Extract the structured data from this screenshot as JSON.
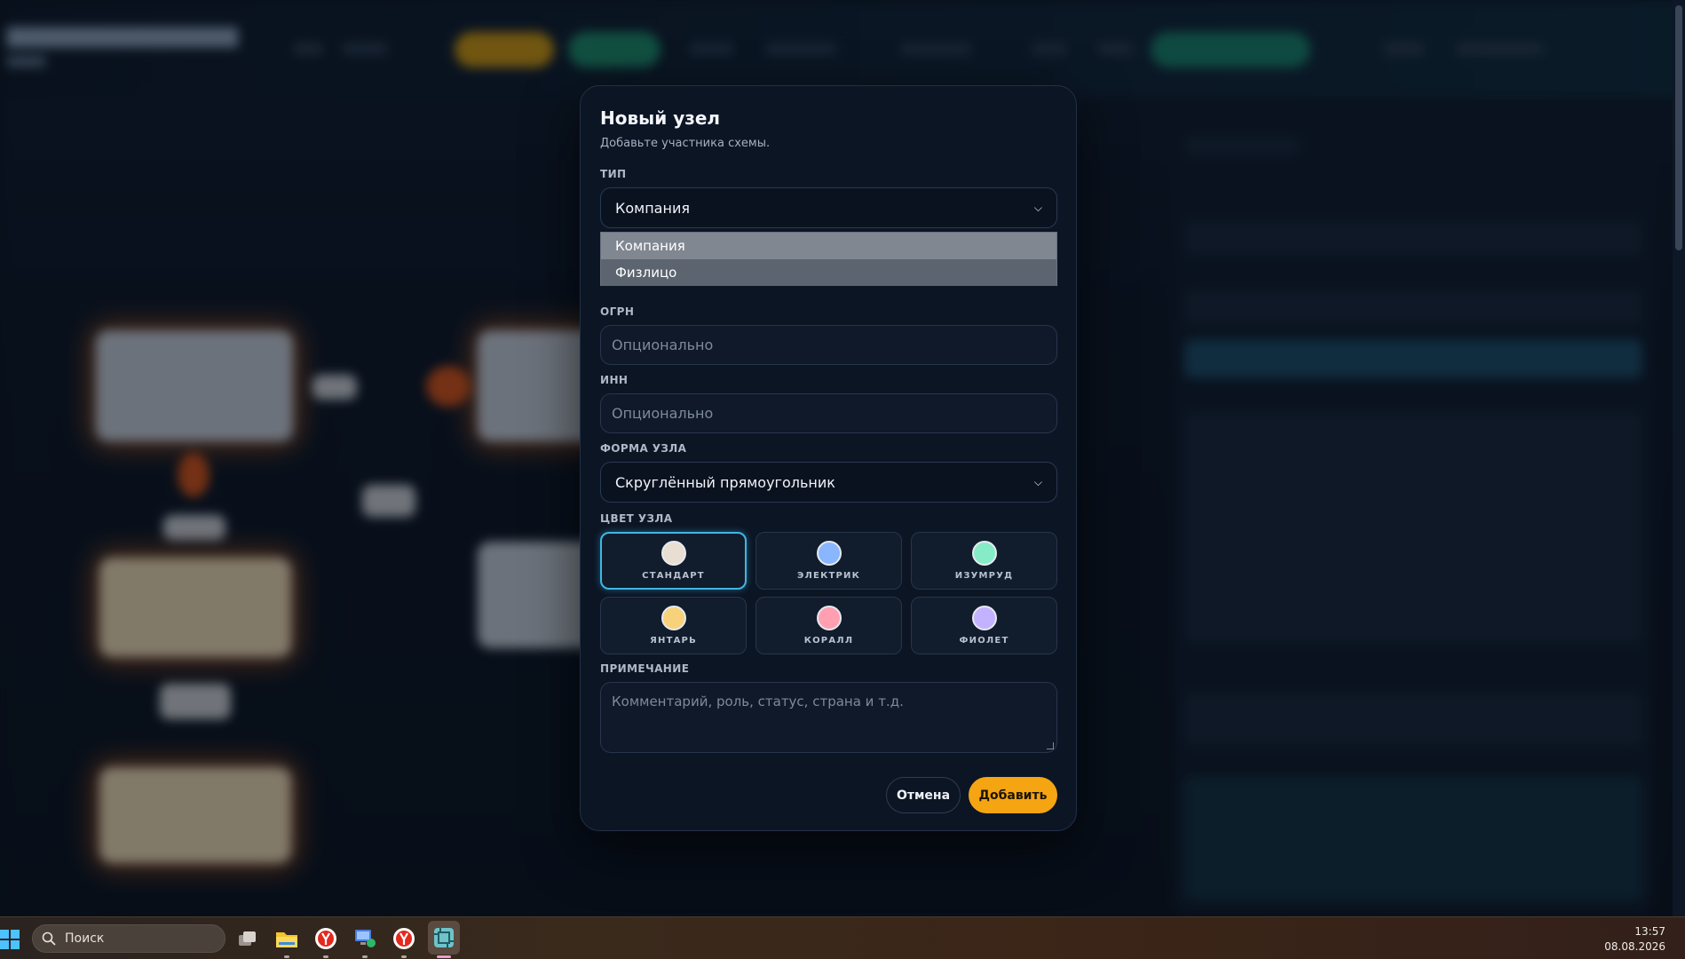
{
  "modal": {
    "title": "Новый узел",
    "subtitle": "Добавьте участника схемы.",
    "type_label": "ТИП",
    "type_value": "Компания",
    "type_options": [
      "Компания",
      "Физлицо"
    ],
    "ogrn_label": "ОГРН",
    "ogrn_placeholder": "Опционально",
    "inn_label": "ИНН",
    "inn_placeholder": "Опционально",
    "shape_label": "ФОРМА УЗЛА",
    "shape_value": "Скруглённый прямоугольник",
    "color_label": "ЦВЕТ УЗЛА",
    "colors": [
      {
        "label": "СТАНДАРТ",
        "color": "#e8dfd2",
        "active": true
      },
      {
        "label": "ЭЛЕКТРИК",
        "color": "#8ab6ff",
        "active": false
      },
      {
        "label": "ИЗУМРУД",
        "color": "#86ecc8",
        "active": false
      },
      {
        "label": "ЯНТАРЬ",
        "color": "#f7d27a",
        "active": false
      },
      {
        "label": "КОРАЛЛ",
        "color": "#ff9fb1",
        "active": false
      },
      {
        "label": "ФИОЛЕТ",
        "color": "#c3b2ff",
        "active": false
      }
    ],
    "note_label": "ПРИМЕЧАНИЕ",
    "note_placeholder": "Комментарий, роль, статус, страна и т.д.",
    "cancel_label": "Отмена",
    "add_label": "Добавить"
  },
  "taskbar": {
    "search_label": "Поиск",
    "time": "13:57",
    "date": "08.08.2026"
  },
  "colors": {
    "accent": "#f5a412",
    "active_border": "#3fb7e6"
  }
}
